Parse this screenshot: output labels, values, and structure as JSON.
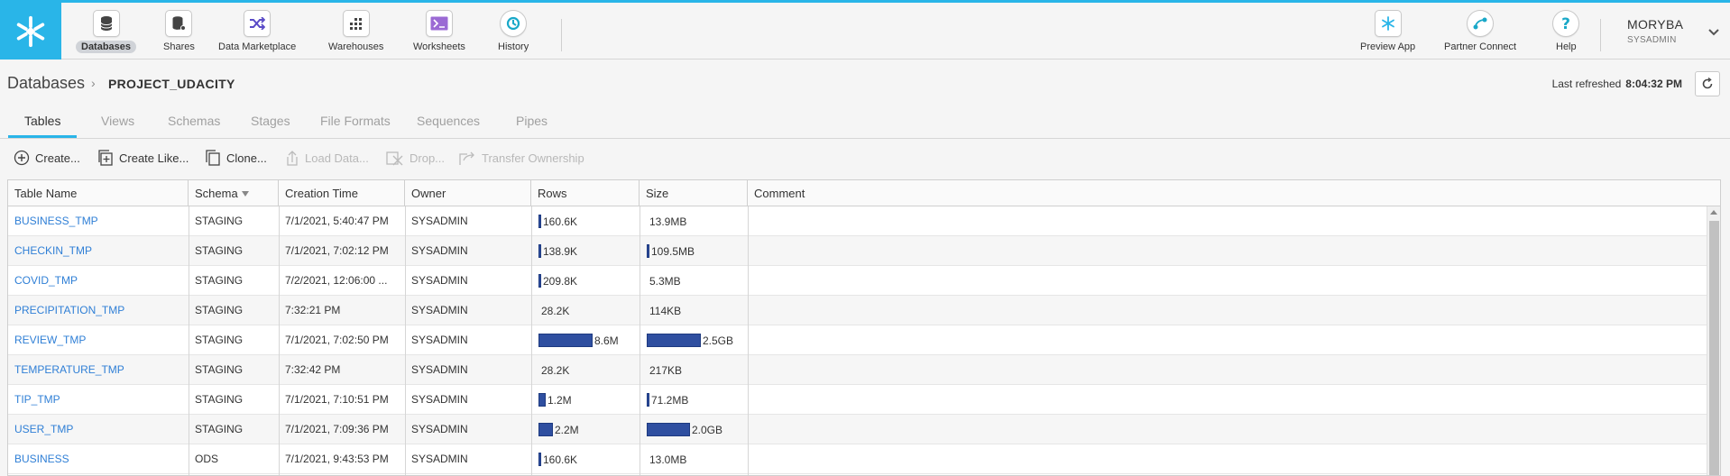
{
  "colors": {
    "accent": "#29b5e8",
    "link": "#2f7fd6",
    "bar": "#2f4fa0"
  },
  "nav": {
    "items": [
      {
        "label": "Databases",
        "icon": "database-icon"
      },
      {
        "label": "Shares",
        "icon": "share-icon"
      },
      {
        "label": "Data Marketplace",
        "icon": "shuffle-icon"
      },
      {
        "label": "Warehouses",
        "icon": "warehouse-grid-icon"
      },
      {
        "label": "Worksheets",
        "icon": "terminal-icon"
      },
      {
        "label": "History",
        "icon": "history-icon"
      }
    ],
    "right_items": [
      {
        "label": "Preview App",
        "icon": "snowflake-icon"
      },
      {
        "label": "Partner Connect",
        "icon": "connect-icon"
      },
      {
        "label": "Help",
        "icon": "help-icon"
      }
    ],
    "user": {
      "name": "MORYBA",
      "role": "SYSADMIN"
    }
  },
  "breadcrumb": {
    "root": "Databases",
    "current": "PROJECT_UDACITY"
  },
  "refresh": {
    "label": "Last refreshed",
    "time": "8:04:32 PM"
  },
  "tabs": [
    "Tables",
    "Views",
    "Schemas",
    "Stages",
    "File Formats",
    "Sequences",
    "Pipes"
  ],
  "toolbar": [
    "Create...",
    "Create Like...",
    "Clone...",
    "Load Data...",
    "Drop...",
    "Transfer Ownership"
  ],
  "table": {
    "columns": [
      "Table Name",
      "Schema",
      "Creation Time",
      "Owner",
      "Rows",
      "Size",
      "Comment"
    ],
    "rows": [
      {
        "name": "BUSINESS_TMP",
        "schema": "STAGING",
        "created": "7/1/2021, 5:40:47 PM",
        "owner": "SYSADMIN",
        "rows": "160.6K",
        "rows_frac": 0.02,
        "size": "13.9MB",
        "size_frac": 0.0
      },
      {
        "name": "CHECKIN_TMP",
        "schema": "STAGING",
        "created": "7/1/2021, 7:02:12 PM",
        "owner": "SYSADMIN",
        "rows": "138.9K",
        "rows_frac": 0.02,
        "size": "109.5MB",
        "size_frac": 0.04
      },
      {
        "name": "COVID_TMP",
        "schema": "STAGING",
        "created": "7/2/2021, 12:06:00 ...",
        "owner": "SYSADMIN",
        "rows": "209.8K",
        "rows_frac": 0.02,
        "size": "5.3MB",
        "size_frac": 0.0
      },
      {
        "name": "PRECIPITATION_TMP",
        "schema": "STAGING",
        "created": "7:32:21 PM",
        "owner": "SYSADMIN",
        "rows": "28.2K",
        "rows_frac": 0.0,
        "size": "114KB",
        "size_frac": 0.0
      },
      {
        "name": "REVIEW_TMP",
        "schema": "STAGING",
        "created": "7/1/2021, 7:02:50 PM",
        "owner": "SYSADMIN",
        "rows": "8.6M",
        "rows_frac": 1.0,
        "size": "2.5GB",
        "size_frac": 1.0
      },
      {
        "name": "TEMPERATURE_TMP",
        "schema": "STAGING",
        "created": "7:32:42 PM",
        "owner": "SYSADMIN",
        "rows": "28.2K",
        "rows_frac": 0.0,
        "size": "217KB",
        "size_frac": 0.0
      },
      {
        "name": "TIP_TMP",
        "schema": "STAGING",
        "created": "7/1/2021, 7:10:51 PM",
        "owner": "SYSADMIN",
        "rows": "1.2M",
        "rows_frac": 0.14,
        "size": "71.2MB",
        "size_frac": 0.03
      },
      {
        "name": "USER_TMP",
        "schema": "STAGING",
        "created": "7/1/2021, 7:09:36 PM",
        "owner": "SYSADMIN",
        "rows": "2.2M",
        "rows_frac": 0.26,
        "size": "2.0GB",
        "size_frac": 0.8
      },
      {
        "name": "BUSINESS",
        "schema": "ODS",
        "created": "7/1/2021, 9:43:53 PM",
        "owner": "SYSADMIN",
        "rows": "160.6K",
        "rows_frac": 0.02,
        "size": "13.0MB",
        "size_frac": 0.0
      }
    ]
  }
}
